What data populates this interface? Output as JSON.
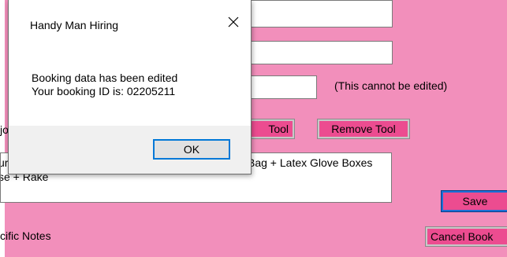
{
  "form": {
    "cannot_edit_note": "(This cannot be edited)",
    "job_label_fragment": "job",
    "tools_text_line1_left": "ure",
    "tools_text_line1": "Bag + Latex Glove Boxes",
    "tools_text_line2": "se + Rake",
    "notes_label_fragment": "cific Notes",
    "add_tool_button_fragment": "Tool",
    "remove_tool_button": "Remove Tool",
    "save_button": "Save",
    "cancel_button_fragment": "Cancel Book"
  },
  "dialog": {
    "title": "Handy Man Hiring",
    "message_line1": "Booking data has been edited",
    "message_line2": "Your booking ID is: 02205211",
    "ok_button": "OK",
    "close_icon": "close-icon"
  },
  "colors": {
    "background": "#f28fbb",
    "button": "#ec4c90",
    "focus_blue": "#0078d7"
  }
}
